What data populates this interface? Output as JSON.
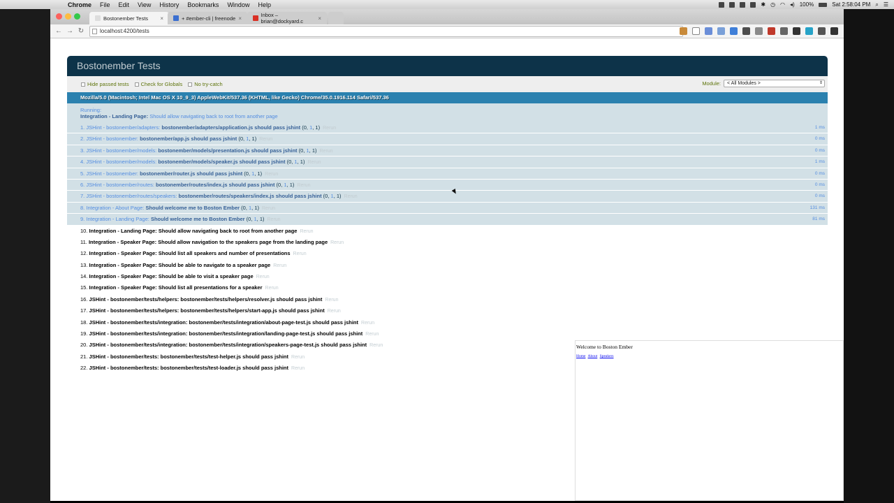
{
  "menubar": {
    "app": "Chrome",
    "items": [
      "File",
      "Edit",
      "View",
      "History",
      "Bookmarks",
      "Window",
      "Help"
    ],
    "battery": "100%",
    "clock": "Sat 2:58:04 PM"
  },
  "browser": {
    "tabs": [
      {
        "label": "Bostonember Tests",
        "fav_color": "#dddddd"
      },
      {
        "label": "+ #ember-cli | freenode",
        "fav_color": "#3b6fd0"
      },
      {
        "label": "Inbox – brian@dockyard.c",
        "fav_color": "#d93025"
      }
    ],
    "url": "localhost:4200/tests"
  },
  "qunit": {
    "title": "Bostonember Tests",
    "hide_passed": "Hide passed tests",
    "check_globals": "Check for Globals",
    "no_try_catch": "No try-catch",
    "module_label": "Module:",
    "module_value": "< All Modules >",
    "user_agent": "Mozilla/5.0 (Macintosh; Intel Mac OS X 10_9_3) AppleWebKit/537.36 (KHTML, like Gecko) Chrome/35.0.1916.114 Safari/537.36",
    "running_label": "Running:",
    "running_title": "Integration - Landing Page:",
    "running_case": "Should allow navigating back to root from another page",
    "rerun": "Rerun",
    "tests": [
      {
        "num": "1.",
        "mod": "JSHint - bostonember/adapters:",
        "msg": "bostonember/adapters/application.js should pass jshint",
        "counts": [
          "0",
          "1",
          "1"
        ],
        "time": "1 ms",
        "done": true
      },
      {
        "num": "2.",
        "mod": "JSHint - bostonember:",
        "msg": "bostonember/app.js should pass jshint",
        "counts": [
          "0",
          "1",
          "1"
        ],
        "time": "0 ms",
        "done": true
      },
      {
        "num": "3.",
        "mod": "JSHint - bostonember/models:",
        "msg": "bostonember/models/presentation.js should pass jshint",
        "counts": [
          "0",
          "1",
          "1"
        ],
        "time": "0 ms",
        "done": true
      },
      {
        "num": "4.",
        "mod": "JSHint - bostonember/models:",
        "msg": "bostonember/models/speaker.js should pass jshint",
        "counts": [
          "0",
          "1",
          "1"
        ],
        "time": "1 ms",
        "done": true
      },
      {
        "num": "5.",
        "mod": "JSHint - bostonember:",
        "msg": "bostonember/router.js should pass jshint",
        "counts": [
          "0",
          "1",
          "1"
        ],
        "time": "0 ms",
        "done": true
      },
      {
        "num": "6.",
        "mod": "JSHint - bostonember/routes:",
        "msg": "bostonember/routes/index.js should pass jshint",
        "counts": [
          "0",
          "1",
          "1"
        ],
        "time": "0 ms",
        "done": true
      },
      {
        "num": "7.",
        "mod": "JSHint - bostonember/routes/speakers:",
        "msg": "bostonember/routes/speakers/index.js should pass jshint",
        "counts": [
          "0",
          "1",
          "1"
        ],
        "time": "0 ms",
        "done": true
      },
      {
        "num": "8.",
        "mod": "Integration - About Page:",
        "msg": "Should welcome me to Boston Ember",
        "counts": [
          "0",
          "1",
          "1"
        ],
        "time": "131 ms",
        "done": true
      },
      {
        "num": "9.",
        "mod": "Integration - Landing Page:",
        "msg": "Should welcome me to Boston Ember",
        "counts": [
          "0",
          "1",
          "1"
        ],
        "time": "81 ms",
        "done": true
      },
      {
        "num": "10.",
        "mod": "Integration - Landing Page:",
        "msg": "Should allow navigating back to root from another page",
        "done": false
      },
      {
        "num": "11.",
        "mod": "Integration - Speaker Page:",
        "msg": "Should allow navigation to the speakers page from the landing page",
        "done": false
      },
      {
        "num": "12.",
        "mod": "Integration - Speaker Page:",
        "msg": "Should list all speakers and number of presentations",
        "done": false
      },
      {
        "num": "13.",
        "mod": "Integration - Speaker Page:",
        "msg": "Should be able to navigate to a speaker page",
        "done": false
      },
      {
        "num": "14.",
        "mod": "Integration - Speaker Page:",
        "msg": "Should be able to visit a speaker page",
        "done": false
      },
      {
        "num": "15.",
        "mod": "Integration - Speaker Page:",
        "msg": "Should list all presentations for a speaker",
        "done": false
      },
      {
        "num": "16.",
        "mod": "JSHint - bostonember/tests/helpers:",
        "msg": "bostonember/tests/helpers/resolver.js should pass jshint",
        "done": false
      },
      {
        "num": "17.",
        "mod": "JSHint - bostonember/tests/helpers:",
        "msg": "bostonember/tests/helpers/start-app.js should pass jshint",
        "done": false
      },
      {
        "num": "18.",
        "mod": "JSHint - bostonember/tests/integration:",
        "msg": "bostonember/tests/integration/about-page-test.js should pass jshint",
        "done": false
      },
      {
        "num": "19.",
        "mod": "JSHint - bostonember/tests/integration:",
        "msg": "bostonember/tests/integration/landing-page-test.js should pass jshint",
        "done": false
      },
      {
        "num": "20.",
        "mod": "JSHint - bostonember/tests/integration:",
        "msg": "bostonember/tests/integration/speakers-page-test.js should pass jshint",
        "done": false
      },
      {
        "num": "21.",
        "mod": "JSHint - bostonember/tests:",
        "msg": "bostonember/tests/test-helper.js should pass jshint",
        "done": false
      },
      {
        "num": "22.",
        "mod": "JSHint - bostonember/tests:",
        "msg": "bostonember/tests/test-loader.js should pass jshint",
        "done": false
      }
    ]
  },
  "fixture": {
    "heading": "Welcome to Boston Ember",
    "links": [
      "Home",
      "About",
      "Speakers"
    ]
  }
}
